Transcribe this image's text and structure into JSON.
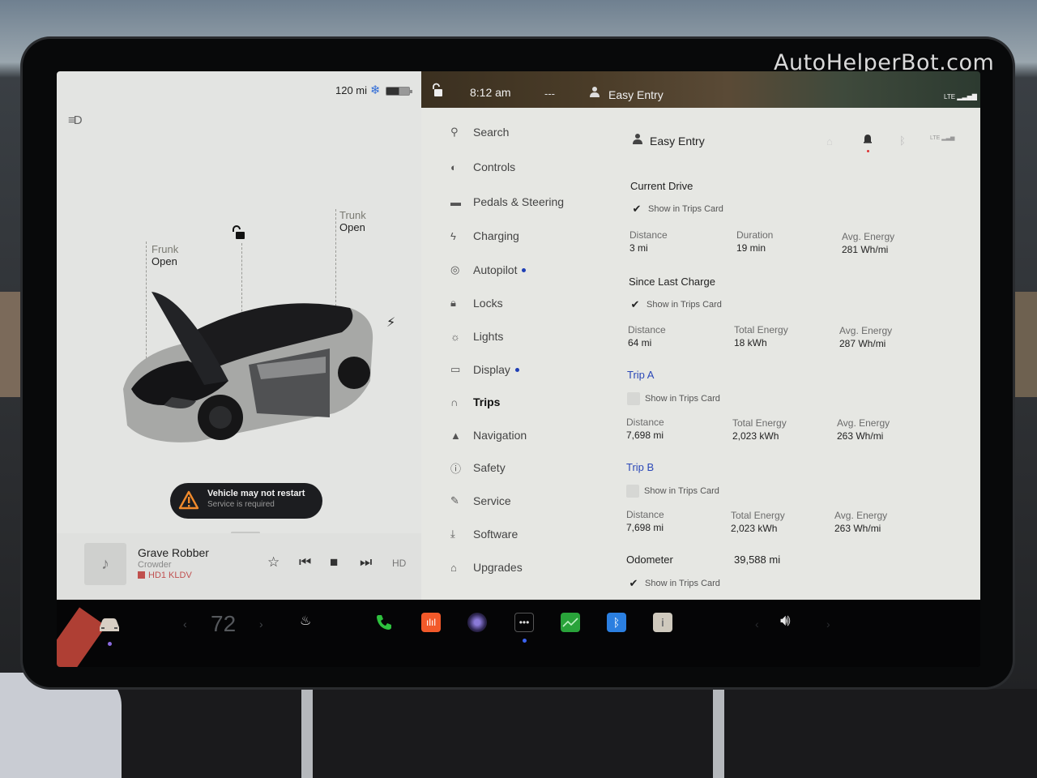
{
  "watermark": "AutoHelperBot.com",
  "vehicle": {
    "range": "120 mi",
    "frunk": {
      "label": "Frunk",
      "state": "Open"
    },
    "trunk": {
      "label": "Trunk",
      "state": "Open"
    },
    "alert": {
      "title": "Vehicle may not restart",
      "subtitle": "Service is required"
    }
  },
  "media": {
    "title": "Grave Robber",
    "artist": "Crowder",
    "station": "HD1 KLDV"
  },
  "status_bar": {
    "time": "8:12 am",
    "outside_temp": "---",
    "profile": "Easy Entry",
    "network": "LTE"
  },
  "nav": {
    "items": [
      {
        "label": "Search",
        "icon": "search-icon",
        "dot": false,
        "active": false
      },
      {
        "label": "Controls",
        "icon": "toggle-icon",
        "dot": false,
        "active": false
      },
      {
        "label": "Pedals & Steering",
        "icon": "car-icon",
        "dot": false,
        "active": false
      },
      {
        "label": "Charging",
        "icon": "bolt-icon",
        "dot": false,
        "active": false
      },
      {
        "label": "Autopilot",
        "icon": "steering-wheel-icon",
        "dot": true,
        "active": false
      },
      {
        "label": "Locks",
        "icon": "lock-icon",
        "dot": false,
        "active": false
      },
      {
        "label": "Lights",
        "icon": "light-icon",
        "dot": false,
        "active": false
      },
      {
        "label": "Display",
        "icon": "display-icon",
        "dot": true,
        "active": false
      },
      {
        "label": "Trips",
        "icon": "trips-icon",
        "dot": false,
        "active": true
      },
      {
        "label": "Navigation",
        "icon": "navigation-icon",
        "dot": false,
        "active": false
      },
      {
        "label": "Safety",
        "icon": "safety-icon",
        "dot": false,
        "active": false
      },
      {
        "label": "Service",
        "icon": "wrench-icon",
        "dot": false,
        "active": false
      },
      {
        "label": "Software",
        "icon": "download-icon",
        "dot": false,
        "active": false
      },
      {
        "label": "Upgrades",
        "icon": "bag-icon",
        "dot": false,
        "active": false
      }
    ]
  },
  "trips": {
    "profile": "Easy Entry",
    "show_label": "Show in Trips Card",
    "current_drive": {
      "title": "Current Drive",
      "show": true,
      "stats": [
        {
          "label": "Distance",
          "value": "3 mi"
        },
        {
          "label": "Duration",
          "value": "19 min"
        },
        {
          "label": "Avg. Energy",
          "value": "281 Wh/mi"
        }
      ]
    },
    "since_last_charge": {
      "title": "Since Last Charge",
      "show": true,
      "stats": [
        {
          "label": "Distance",
          "value": "64 mi"
        },
        {
          "label": "Total Energy",
          "value": "18 kWh"
        },
        {
          "label": "Avg. Energy",
          "value": "287 Wh/mi"
        }
      ]
    },
    "trip_a": {
      "title": "Trip A",
      "show": false,
      "stats": [
        {
          "label": "Distance",
          "value": "7,698 mi"
        },
        {
          "label": "Total Energy",
          "value": "2,023 kWh"
        },
        {
          "label": "Avg. Energy",
          "value": "263 Wh/mi"
        }
      ]
    },
    "trip_b": {
      "title": "Trip B",
      "show": false,
      "stats": [
        {
          "label": "Distance",
          "value": "7,698 mi"
        },
        {
          "label": "Total Energy",
          "value": "2,023 kWh"
        },
        {
          "label": "Avg. Energy",
          "value": "263 Wh/mi"
        }
      ]
    },
    "odometer": {
      "label": "Odometer",
      "value": "39,588 mi",
      "show": true
    }
  },
  "dock": {
    "cabin_temp": "72",
    "colors": {
      "phone": "#2ec13e",
      "music": "#f2592a",
      "camera": "#4b3a8a",
      "energy": "#29a33a",
      "bluetooth": "#2b7fe0",
      "accent_dot": "#3b63f0"
    }
  }
}
